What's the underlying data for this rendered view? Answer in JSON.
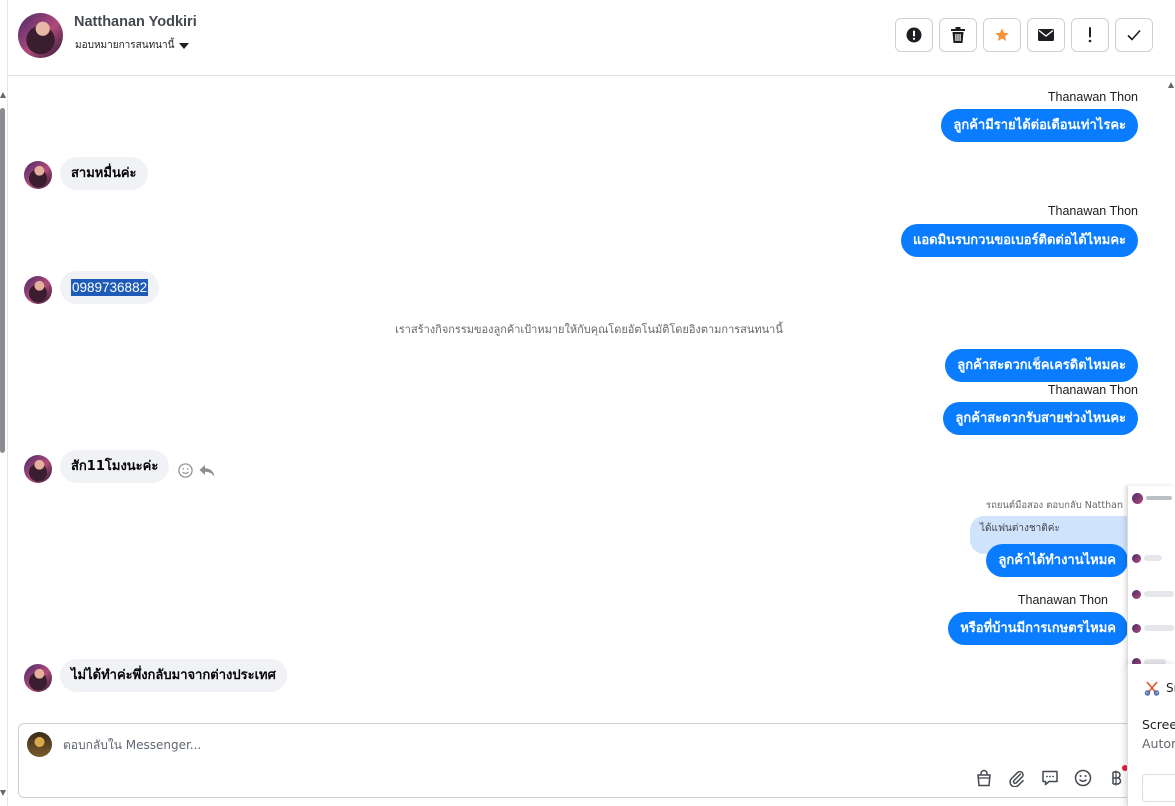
{
  "header": {
    "contact_name": "Natthanan Yodkiri",
    "assign_label": "มอบหมายการสนทนานี้",
    "actions": [
      {
        "name": "spam-button",
        "icon": "alert-circle-icon"
      },
      {
        "name": "delete-button",
        "icon": "trash-icon"
      },
      {
        "name": "star-button",
        "icon": "star-icon"
      },
      {
        "name": "mark-unread-button",
        "icon": "envelope-icon"
      },
      {
        "name": "follow-up-button",
        "icon": "exclamation-icon"
      },
      {
        "name": "mark-done-button",
        "icon": "check-icon"
      }
    ],
    "star_color": "#f7923a"
  },
  "thread": {
    "agent_name": "Thanawan Thon",
    "messages": {
      "m1": "ลูกค้ามีรายได้ต่อเดือนเท่าไรคะ",
      "m2": "สามหมื่นค่ะ",
      "m3": "แอดมินรบกวนขอเบอร์ติดต่อได้ไหมคะ",
      "m4": "0989736882",
      "system_note": "เราสร้างกิจกรรมของลูกค้าเป้าหมายให้กับคุณโดยอัตโนมัติโดยอิงตามการสนทนานี้",
      "m5": "ลูกค้าสะดวกเช็คเครดิตไหมคะ",
      "m6": "ลูกค้าสะดวกรับสายช่วงไหนคะ",
      "m7": "สัก11โมงนะค่ะ",
      "reply_meta": "รถยนต์มือสอง ตอบกลับ Natthan",
      "quoted": "ได้แฟนต่างชาติค่ะ",
      "m8": "ลูกค้าได้ทำงานไหมค",
      "m9": "หรือที่บ้านมีการเกษตรไหมค",
      "m10": "ไม่ได้ทำค่ะพึ่งกลับมาจากต่างประเทศ"
    },
    "bubble_color": "#0a7cff"
  },
  "composer": {
    "placeholder": "ตอบกลับใน Messenger...",
    "tools": [
      "shop-bag-icon",
      "paperclip-icon",
      "saved-reply-icon",
      "emoji-icon",
      "baht-icon"
    ]
  },
  "overlay": {
    "title": "Sn",
    "line1": "Scree",
    "line2": "Autor"
  }
}
